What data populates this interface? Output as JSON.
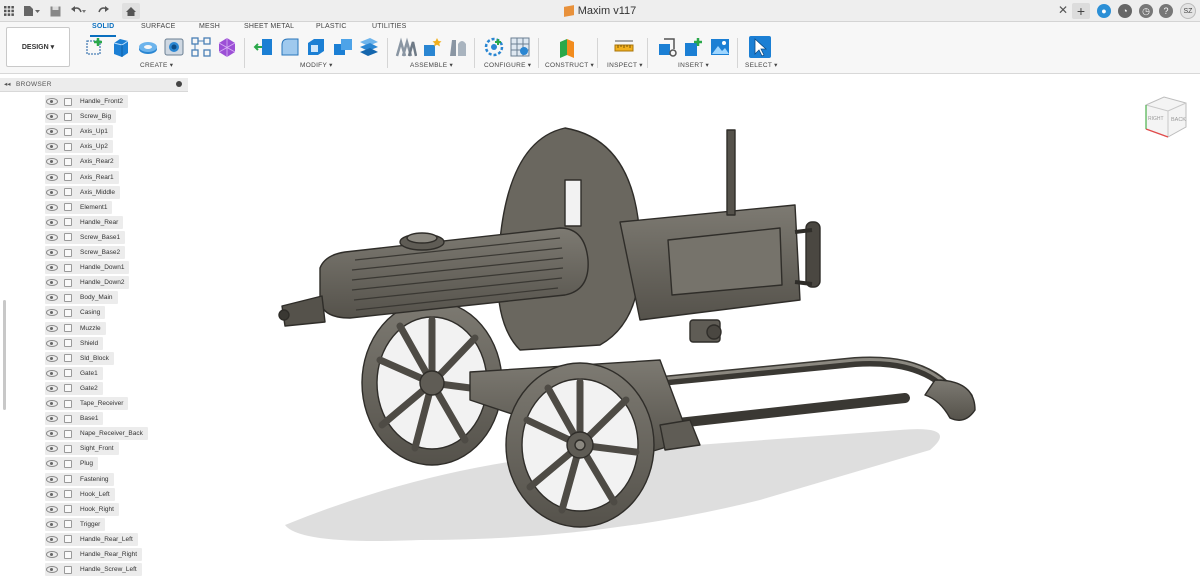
{
  "app": {
    "doc_title": "Maxim v117",
    "user_initials": "SZ"
  },
  "titlebar_icons": [
    "grid-icon",
    "file-icon",
    "save-icon",
    "undo-icon",
    "redo-icon",
    "home-icon",
    "close-icon",
    "plus-icon",
    "extensions-icon",
    "job-status-icon",
    "notifications-icon",
    "help-icon"
  ],
  "ribbon": {
    "tabs": [
      {
        "label": "SOLID",
        "active": true
      },
      {
        "label": "SURFACE",
        "active": false
      },
      {
        "label": "MESH",
        "active": false
      },
      {
        "label": "SHEET METAL",
        "active": false
      },
      {
        "label": "PLASTIC",
        "active": false
      },
      {
        "label": "UTILITIES",
        "active": false
      }
    ],
    "workspace": "DESIGN ▾",
    "groups": [
      {
        "label": "CREATE ▾"
      },
      {
        "label": "MODIFY ▾"
      },
      {
        "label": "ASSEMBLE ▾"
      },
      {
        "label": "CONFIGURE ▾"
      },
      {
        "label": "CONSTRUCT ▾"
      },
      {
        "label": "INSPECT ▾"
      },
      {
        "label": "INSERT ▾"
      },
      {
        "label": "SELECT ▾"
      }
    ],
    "accent": "#0a6fbf"
  },
  "browser": {
    "title": "BROWSER",
    "items": [
      {
        "label": "Handle_Front2"
      },
      {
        "label": "Screw_Big"
      },
      {
        "label": "Axis_Up1"
      },
      {
        "label": "Axis_Up2"
      },
      {
        "label": "Axis_Rear2"
      },
      {
        "label": "Axis_Rear1"
      },
      {
        "label": "Axis_Middle"
      },
      {
        "label": "Element1"
      },
      {
        "label": "Handle_Rear"
      },
      {
        "label": "Screw_Base1"
      },
      {
        "label": "Screw_Base2"
      },
      {
        "label": "Handle_Down1"
      },
      {
        "label": "Handle_Down2"
      },
      {
        "label": "Body_Main"
      },
      {
        "label": "Casing"
      },
      {
        "label": "Muzzle"
      },
      {
        "label": "Shield"
      },
      {
        "label": "Sld_Block"
      },
      {
        "label": "Gate1"
      },
      {
        "label": "Gate2"
      },
      {
        "label": "Tape_Receiver"
      },
      {
        "label": "Base1"
      },
      {
        "label": "Nape_Receiver_Back"
      },
      {
        "label": "Sight_Front"
      },
      {
        "label": "Plug"
      },
      {
        "label": "Fastening"
      },
      {
        "label": "Hook_Left"
      },
      {
        "label": "Hook_Right"
      },
      {
        "label": "Trigger"
      },
      {
        "label": "Handle_Rear_Left"
      },
      {
        "label": "Handle_Rear_Right"
      },
      {
        "label": "Handle_Screw_Left"
      }
    ]
  },
  "viewcube": {
    "faces": [
      "RIGHT",
      "BACK"
    ]
  },
  "model_color": "#66635c"
}
